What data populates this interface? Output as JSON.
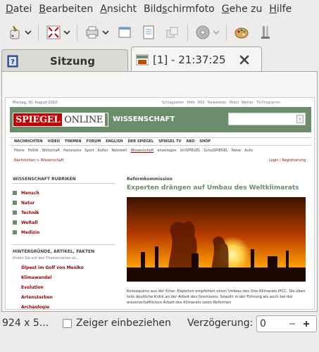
{
  "menubar": {
    "items": [
      {
        "prefix": "",
        "underline": "D",
        "rest": "atei"
      },
      {
        "prefix": "",
        "underline": "B",
        "rest": "earbeiten"
      },
      {
        "prefix": "",
        "underline": "A",
        "rest": "nsicht"
      },
      {
        "prefix": "Bild",
        "underline": "s",
        "rest": "chirmfoto"
      },
      {
        "prefix": "",
        "underline": "G",
        "rest": "ehe zu"
      },
      {
        "prefix": "",
        "underline": "H",
        "rest": "ilfe"
      }
    ]
  },
  "toolbar": {
    "icons": [
      "clean-icon",
      "fit-icon",
      "print-icon",
      "window-icon",
      "document-icon",
      "copy-icon",
      "disc-icon",
      "palette-icon",
      "tools-icon"
    ]
  },
  "tabs": [
    {
      "label": "Sitzung"
    },
    {
      "label": "[1] - 21:37:25"
    }
  ],
  "website": {
    "date": "Montag, 30. August 2010",
    "toplinks": [
      "Schlagzeilen",
      "Hilfe",
      "RSS",
      "Newsletter",
      "Mobil",
      "Wetter",
      "TV-Programm"
    ],
    "logo_a": "SPIEGEL",
    "logo_b": "ONLINE",
    "section": "WISSENSCHAFT",
    "nav": [
      "NACHRICHTEN",
      "VIDEO",
      "THEMEN",
      "FORUM",
      "ENGLISH",
      "DER SPIEGEL",
      "SPIEGEL TV",
      "ABO",
      "SHOP"
    ],
    "subnav": [
      "Home",
      "Politik",
      "Wirtschaft",
      "Panorama",
      "Sport",
      "Kultur",
      "Netzwelt",
      "Wissenschaft",
      "einestages",
      "UniSPIEGEL",
      "SchulSPIEGEL",
      "Reise",
      "Auto"
    ],
    "breadcrumb": "Nachrichten > Wissenschaft",
    "login": "Login | Registrierung",
    "sidebar_heading": "WISSENSCHAFT RUBRIKEN",
    "sidebar_items": [
      "Mensch",
      "Natur",
      "Technik",
      "Weltall",
      "Medizin"
    ],
    "sidebar_heading2": "HINTERGRÜNDE, ARTIKEL, FAKTEN",
    "sidebar_small": "finden Sie auf den Themenseiten zu...",
    "sidebar_links": [
      "Ölpest im Golf von Mexiko",
      "Klimawandel",
      "Evolution",
      "Artensterben",
      "Archäologie"
    ],
    "kicker": "Reformkommission",
    "headline": "Experten drängen auf Umbau des Weltklimarats",
    "teaser": "Konsequenz aus der Krise: Experten empfehlen einen Umbau des Uno-Klimarats IPCC. Sie üben teils deutliche Kritik an der Arbeit des Gremiums. Sowohl in der Führung als auch bei der wissenschaftlichen Arbeit des Klimarats seien Reformen"
  },
  "statusbar": {
    "size": "924 x 5...",
    "include_pointer": "Zeiger einbeziehen",
    "include_pointer_checked": false,
    "delay_label": "Verzögerung:",
    "delay_value": "0"
  }
}
